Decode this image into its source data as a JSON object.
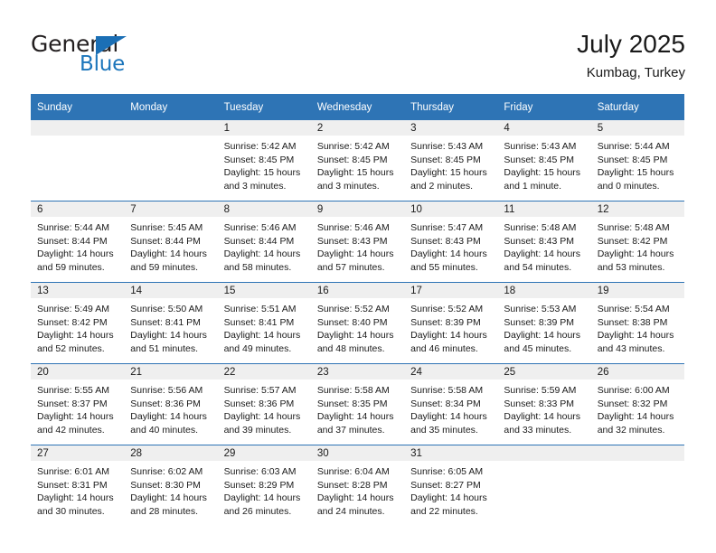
{
  "brand": {
    "name_top": "General",
    "name_bottom": "Blue",
    "accent_color": "#1b75bb",
    "flag_icon": "triangle-flag-icon"
  },
  "header": {
    "title": "July 2025",
    "subtitle": "Kumbag, Turkey"
  },
  "theme": {
    "header_bg": "#2e74b5",
    "header_text": "#ffffff",
    "daynum_bg": "#efefef",
    "row_divider": "#2e74b5",
    "body_text": "#1a1a1a"
  },
  "calendar": {
    "weekday_headers": [
      "Sunday",
      "Monday",
      "Tuesday",
      "Wednesday",
      "Thursday",
      "Friday",
      "Saturday"
    ],
    "labels": {
      "sunrise": "Sunrise:",
      "sunset": "Sunset:",
      "daylight": "Daylight:"
    },
    "weeks": [
      [
        {
          "day": "",
          "sunrise": "",
          "sunset": "",
          "daylight": ""
        },
        {
          "day": "",
          "sunrise": "",
          "sunset": "",
          "daylight": ""
        },
        {
          "day": "1",
          "sunrise": "Sunrise: 5:42 AM",
          "sunset": "Sunset: 8:45 PM",
          "daylight": "Daylight: 15 hours and 3 minutes."
        },
        {
          "day": "2",
          "sunrise": "Sunrise: 5:42 AM",
          "sunset": "Sunset: 8:45 PM",
          "daylight": "Daylight: 15 hours and 3 minutes."
        },
        {
          "day": "3",
          "sunrise": "Sunrise: 5:43 AM",
          "sunset": "Sunset: 8:45 PM",
          "daylight": "Daylight: 15 hours and 2 minutes."
        },
        {
          "day": "4",
          "sunrise": "Sunrise: 5:43 AM",
          "sunset": "Sunset: 8:45 PM",
          "daylight": "Daylight: 15 hours and 1 minute."
        },
        {
          "day": "5",
          "sunrise": "Sunrise: 5:44 AM",
          "sunset": "Sunset: 8:45 PM",
          "daylight": "Daylight: 15 hours and 0 minutes."
        }
      ],
      [
        {
          "day": "6",
          "sunrise": "Sunrise: 5:44 AM",
          "sunset": "Sunset: 8:44 PM",
          "daylight": "Daylight: 14 hours and 59 minutes."
        },
        {
          "day": "7",
          "sunrise": "Sunrise: 5:45 AM",
          "sunset": "Sunset: 8:44 PM",
          "daylight": "Daylight: 14 hours and 59 minutes."
        },
        {
          "day": "8",
          "sunrise": "Sunrise: 5:46 AM",
          "sunset": "Sunset: 8:44 PM",
          "daylight": "Daylight: 14 hours and 58 minutes."
        },
        {
          "day": "9",
          "sunrise": "Sunrise: 5:46 AM",
          "sunset": "Sunset: 8:43 PM",
          "daylight": "Daylight: 14 hours and 57 minutes."
        },
        {
          "day": "10",
          "sunrise": "Sunrise: 5:47 AM",
          "sunset": "Sunset: 8:43 PM",
          "daylight": "Daylight: 14 hours and 55 minutes."
        },
        {
          "day": "11",
          "sunrise": "Sunrise: 5:48 AM",
          "sunset": "Sunset: 8:43 PM",
          "daylight": "Daylight: 14 hours and 54 minutes."
        },
        {
          "day": "12",
          "sunrise": "Sunrise: 5:48 AM",
          "sunset": "Sunset: 8:42 PM",
          "daylight": "Daylight: 14 hours and 53 minutes."
        }
      ],
      [
        {
          "day": "13",
          "sunrise": "Sunrise: 5:49 AM",
          "sunset": "Sunset: 8:42 PM",
          "daylight": "Daylight: 14 hours and 52 minutes."
        },
        {
          "day": "14",
          "sunrise": "Sunrise: 5:50 AM",
          "sunset": "Sunset: 8:41 PM",
          "daylight": "Daylight: 14 hours and 51 minutes."
        },
        {
          "day": "15",
          "sunrise": "Sunrise: 5:51 AM",
          "sunset": "Sunset: 8:41 PM",
          "daylight": "Daylight: 14 hours and 49 minutes."
        },
        {
          "day": "16",
          "sunrise": "Sunrise: 5:52 AM",
          "sunset": "Sunset: 8:40 PM",
          "daylight": "Daylight: 14 hours and 48 minutes."
        },
        {
          "day": "17",
          "sunrise": "Sunrise: 5:52 AM",
          "sunset": "Sunset: 8:39 PM",
          "daylight": "Daylight: 14 hours and 46 minutes."
        },
        {
          "day": "18",
          "sunrise": "Sunrise: 5:53 AM",
          "sunset": "Sunset: 8:39 PM",
          "daylight": "Daylight: 14 hours and 45 minutes."
        },
        {
          "day": "19",
          "sunrise": "Sunrise: 5:54 AM",
          "sunset": "Sunset: 8:38 PM",
          "daylight": "Daylight: 14 hours and 43 minutes."
        }
      ],
      [
        {
          "day": "20",
          "sunrise": "Sunrise: 5:55 AM",
          "sunset": "Sunset: 8:37 PM",
          "daylight": "Daylight: 14 hours and 42 minutes."
        },
        {
          "day": "21",
          "sunrise": "Sunrise: 5:56 AM",
          "sunset": "Sunset: 8:36 PM",
          "daylight": "Daylight: 14 hours and 40 minutes."
        },
        {
          "day": "22",
          "sunrise": "Sunrise: 5:57 AM",
          "sunset": "Sunset: 8:36 PM",
          "daylight": "Daylight: 14 hours and 39 minutes."
        },
        {
          "day": "23",
          "sunrise": "Sunrise: 5:58 AM",
          "sunset": "Sunset: 8:35 PM",
          "daylight": "Daylight: 14 hours and 37 minutes."
        },
        {
          "day": "24",
          "sunrise": "Sunrise: 5:58 AM",
          "sunset": "Sunset: 8:34 PM",
          "daylight": "Daylight: 14 hours and 35 minutes."
        },
        {
          "day": "25",
          "sunrise": "Sunrise: 5:59 AM",
          "sunset": "Sunset: 8:33 PM",
          "daylight": "Daylight: 14 hours and 33 minutes."
        },
        {
          "day": "26",
          "sunrise": "Sunrise: 6:00 AM",
          "sunset": "Sunset: 8:32 PM",
          "daylight": "Daylight: 14 hours and 32 minutes."
        }
      ],
      [
        {
          "day": "27",
          "sunrise": "Sunrise: 6:01 AM",
          "sunset": "Sunset: 8:31 PM",
          "daylight": "Daylight: 14 hours and 30 minutes."
        },
        {
          "day": "28",
          "sunrise": "Sunrise: 6:02 AM",
          "sunset": "Sunset: 8:30 PM",
          "daylight": "Daylight: 14 hours and 28 minutes."
        },
        {
          "day": "29",
          "sunrise": "Sunrise: 6:03 AM",
          "sunset": "Sunset: 8:29 PM",
          "daylight": "Daylight: 14 hours and 26 minutes."
        },
        {
          "day": "30",
          "sunrise": "Sunrise: 6:04 AM",
          "sunset": "Sunset: 8:28 PM",
          "daylight": "Daylight: 14 hours and 24 minutes."
        },
        {
          "day": "31",
          "sunrise": "Sunrise: 6:05 AM",
          "sunset": "Sunset: 8:27 PM",
          "daylight": "Daylight: 14 hours and 22 minutes."
        },
        {
          "day": "",
          "sunrise": "",
          "sunset": "",
          "daylight": ""
        },
        {
          "day": "",
          "sunrise": "",
          "sunset": "",
          "daylight": ""
        }
      ]
    ]
  }
}
